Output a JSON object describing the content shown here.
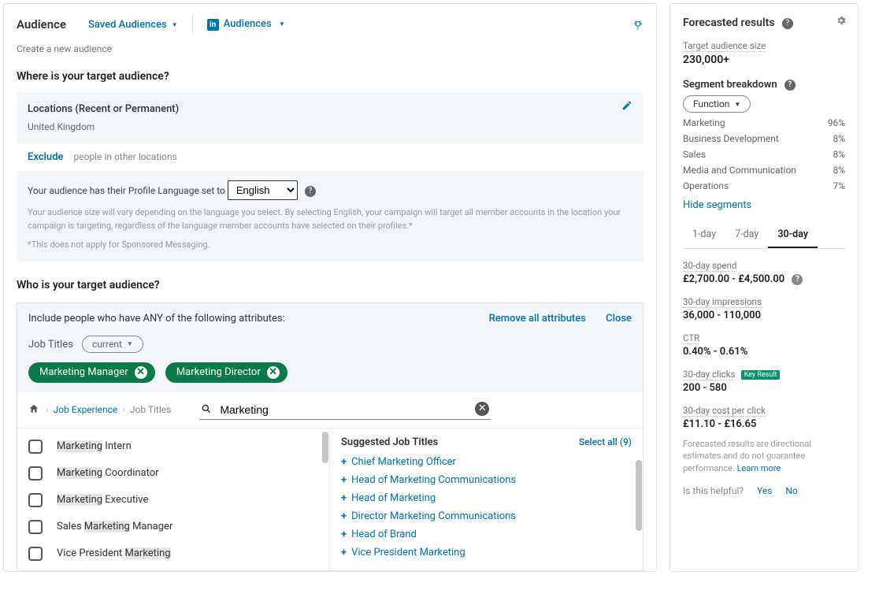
{
  "header": {
    "title": "Audience",
    "saved_audiences": "Saved Audiences",
    "audiences": "Audiences",
    "idea_icon": "lightbulb-icon"
  },
  "create_link": "Create a new audience",
  "where": {
    "heading": "Where is your target audience?",
    "box_title": "Locations (Recent or Permanent)",
    "value": "United Kingdom",
    "exclude_label": "Exclude",
    "exclude_text": "people in other locations"
  },
  "lang": {
    "prefix": "Your audience has their Profile Language set to",
    "value": "English",
    "note1": "Your audience size will vary depending on the language you select. By selecting English, your campaign will target all member accounts in the location your campaign is targeting, regardless of the language member accounts have selected on their profiles.*",
    "note2": "*This does not apply for Sponsored Messaging."
  },
  "who": {
    "heading": "Who is your target audience?",
    "include_text": "Include people who have ANY of the following attributes:",
    "remove_all": "Remove all attributes",
    "close": "Close",
    "filter_label": "Job Titles",
    "filter_mode": "current",
    "tags": [
      "Marketing Manager",
      "Marketing Director"
    ],
    "breadcrumb": {
      "home": "home-icon",
      "lvl1": "Job Experience",
      "lvl2": "Job Titles"
    },
    "search_value": "Marketing",
    "results": [
      {
        "prefix": "Marketing",
        "rest": " Intern"
      },
      {
        "prefix": "Marketing",
        "rest": " Coordinator"
      },
      {
        "prefix": "Marketing",
        "rest": " Executive"
      },
      {
        "prefix": "",
        "rest_a": "Sales ",
        "mid": "Marketing",
        "rest_b": " Manager"
      },
      {
        "prefix": "",
        "rest_a": "Vice President ",
        "mid": "Marketing",
        "rest_b": ""
      }
    ],
    "sugg_title": "Suggested Job Titles",
    "select_all": "Select all (9)",
    "suggestions": [
      "Chief Marketing Officer",
      "Head of Marketing Communications",
      "Head of Marketing",
      "Director Marketing Communications",
      "Head of Brand",
      "Vice President Marketing"
    ]
  },
  "forecast": {
    "title": "Forecasted results",
    "audience_size_label": "Target audience size",
    "audience_size": "230,000+",
    "segment_heading": "Segment breakdown",
    "segment_select": "Function",
    "segments": [
      {
        "name": "Marketing",
        "pct": "96%"
      },
      {
        "name": "Business Development",
        "pct": "8%"
      },
      {
        "name": "Sales",
        "pct": "8%"
      },
      {
        "name": "Media and Communication",
        "pct": "8%"
      },
      {
        "name": "Operations",
        "pct": "7%"
      }
    ],
    "hide_segments": "Hide segments",
    "tabs": [
      "1-day",
      "7-day",
      "30-day"
    ],
    "spend_label": "30-day spend",
    "spend": "£2,700.00 - £4,500.00",
    "impressions_label": "30-day impressions",
    "impressions": "36,000 - 110,000",
    "ctr_label": "CTR",
    "ctr": "0.40% - 0.61%",
    "clicks_label": "30-day clicks",
    "clicks_badge": "Key Result",
    "clicks": "200 - 580",
    "cpc_label": "30-day cost per click",
    "cpc": "£11.10 - £16.65",
    "disclaimer": "Forecasted results are directional estimates and do not guarantee performance.",
    "learn_more": "Learn more",
    "helpful": "Is this helpful?",
    "yes": "Yes",
    "no": "No"
  }
}
